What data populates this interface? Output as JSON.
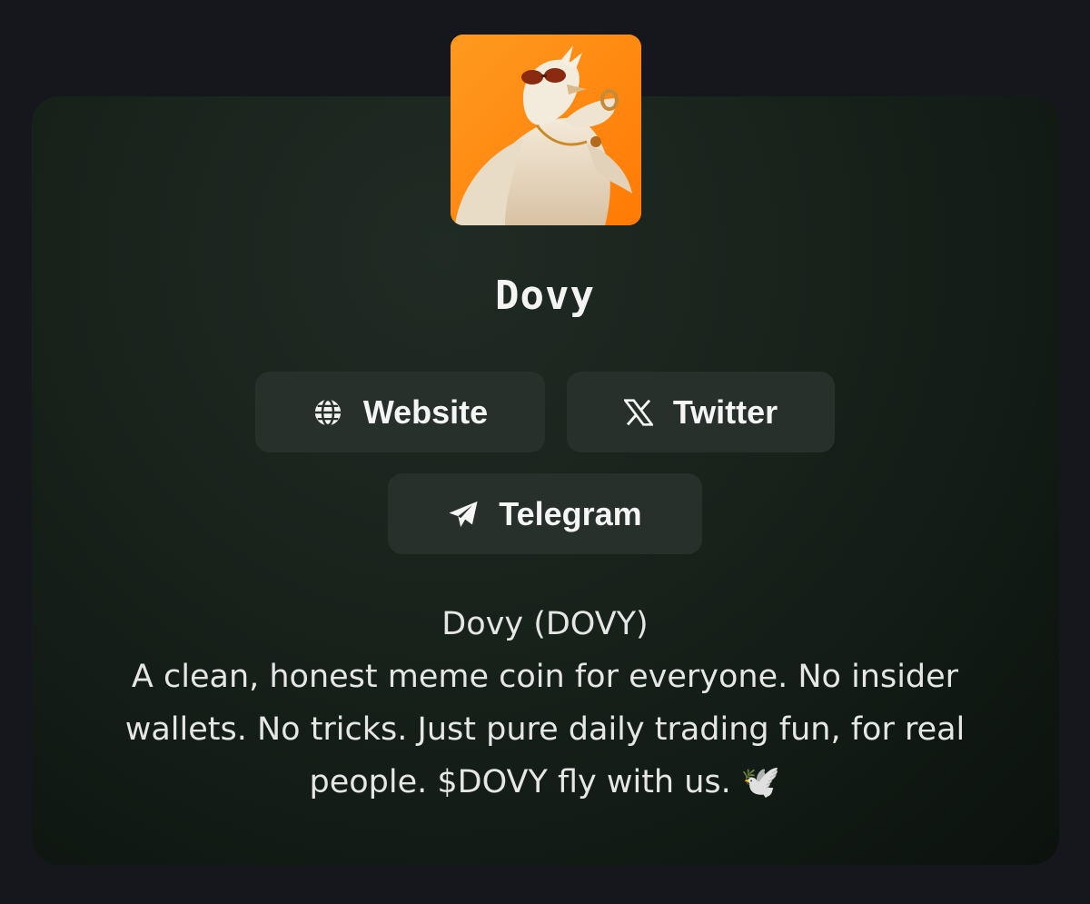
{
  "profile": {
    "name": "Dovy"
  },
  "links": {
    "website_label": "Website",
    "twitter_label": "Twitter",
    "telegram_label": "Telegram"
  },
  "description": {
    "ticker_line": "Dovy (DOVY)",
    "body": "A clean, honest meme coin for everyone. No insider wallets. No tricks. Just pure daily trading fun, for real people. $DOVY fly with us. 🕊️"
  },
  "icons": {
    "website": "globe-icon",
    "twitter": "x-logo-icon",
    "telegram": "telegram-plane-icon"
  },
  "colors": {
    "page_background": "#16161d",
    "card_background": "#17221b",
    "button_background": "#28302c",
    "avatar_background": "#ff8a12",
    "text": "#f5f5f5"
  }
}
